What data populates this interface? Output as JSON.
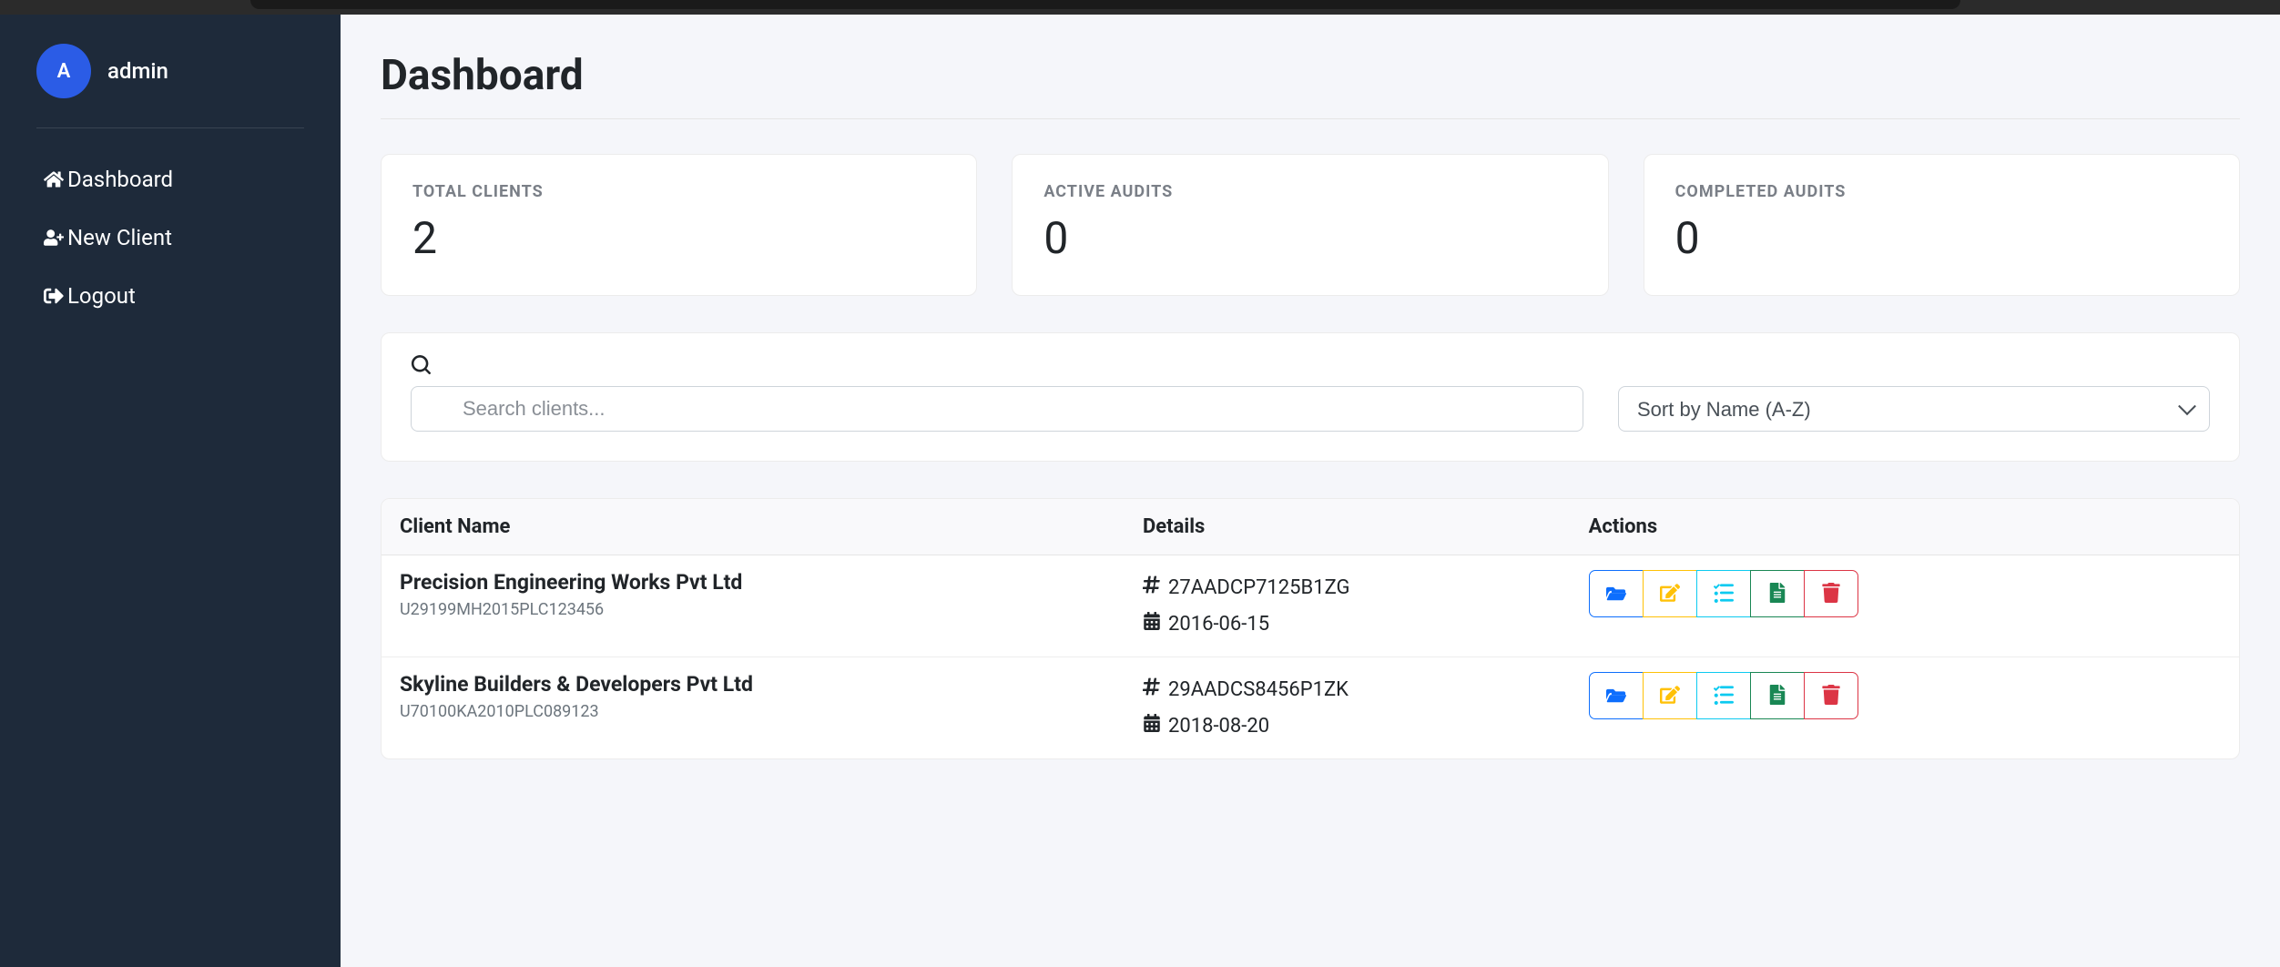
{
  "sidebar": {
    "avatar_letter": "A",
    "username": "admin",
    "nav": {
      "dashboard": "Dashboard",
      "new_client": "New Client",
      "logout": "Logout"
    }
  },
  "page": {
    "title": "Dashboard"
  },
  "stats": {
    "total_clients": {
      "label": "TOTAL CLIENTS",
      "value": "2"
    },
    "active_audits": {
      "label": "ACTIVE AUDITS",
      "value": "0"
    },
    "completed_audits": {
      "label": "COMPLETED AUDITS",
      "value": "0"
    }
  },
  "toolbar": {
    "search_placeholder": "Search clients...",
    "sort_selected": "Sort by Name (A-Z)"
  },
  "table": {
    "headers": {
      "client_name": "Client Name",
      "details": "Details",
      "actions": "Actions"
    },
    "rows": [
      {
        "name": "Precision Engineering Works Pvt Ltd",
        "subid": "U29199MH2015PLC123456",
        "code": "27AADCP7125B1ZG",
        "date": "2016-06-15"
      },
      {
        "name": "Skyline Builders & Developers Pvt Ltd",
        "subid": "U70100KA2010PLC089123",
        "code": "29AADCS8456P1ZK",
        "date": "2018-08-20"
      }
    ]
  }
}
